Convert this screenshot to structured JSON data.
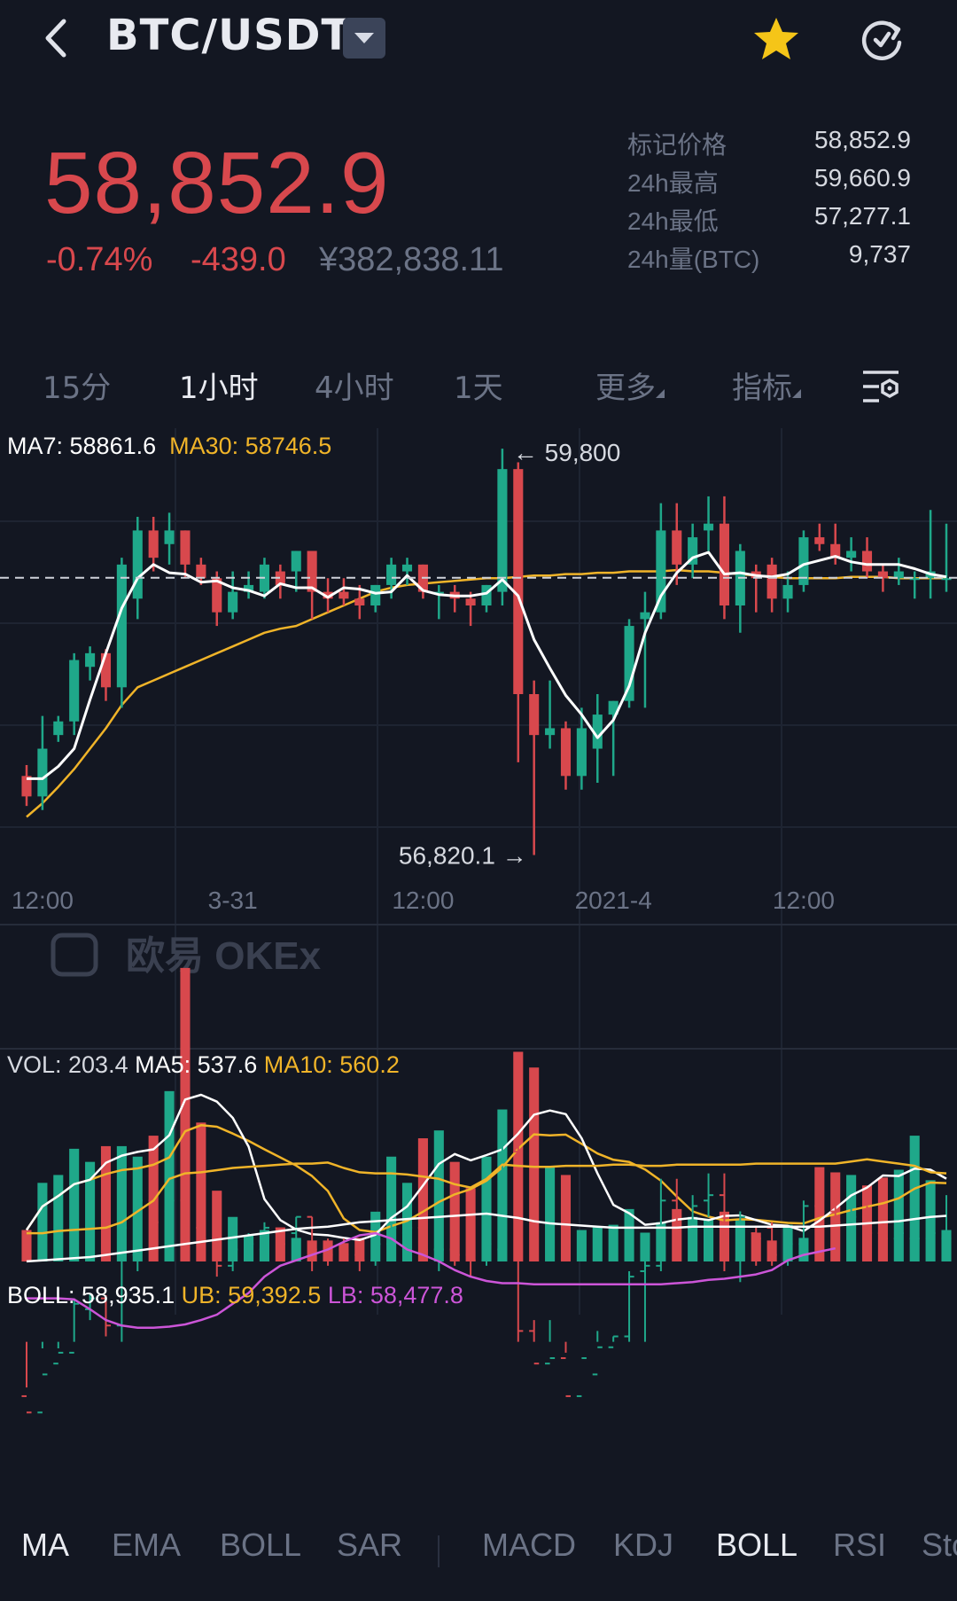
{
  "header": {
    "pair": "BTC/USDT",
    "icons": {
      "back": "back-chevron-icon",
      "dropdown": "triangle-down-icon",
      "favorite": "star-icon",
      "refresh": "refresh-icon"
    },
    "star_color": "#f5c518"
  },
  "ticker": {
    "last_price": "58,852.9",
    "change_pct": "-0.74%",
    "change_abs": "-439.0",
    "cny_value": "¥382,838.11",
    "down_color": "#d8484d"
  },
  "stats": [
    {
      "label": "标记价格",
      "value": "58,852.9"
    },
    {
      "label": "24h最高",
      "value": "59,660.9"
    },
    {
      "label": "24h最低",
      "value": "57,277.1"
    },
    {
      "label": "24h量(BTC)",
      "value": "9,737"
    }
  ],
  "intervals": [
    {
      "label": "15分",
      "active": false
    },
    {
      "label": "1小时",
      "active": true
    },
    {
      "label": "4小时",
      "active": false
    },
    {
      "label": "1天",
      "active": false
    },
    {
      "label": "更多",
      "active": false
    },
    {
      "label": "指标",
      "active": false
    }
  ],
  "main_legend": {
    "ma7": "MA7: 58861.6",
    "ma30": "MA30: 58746.5"
  },
  "annotations": {
    "high": "← 59,800",
    "low": "56,820.1 →",
    "watermark": "欧易 OKEx"
  },
  "time_axis": [
    "12:00",
    "3-31",
    "12:00",
    "2021-4",
    "12:00"
  ],
  "vol_legend": {
    "vol": "VOL: 203.4",
    "ma5": "MA5: 537.6",
    "ma10": "MA10: 560.2"
  },
  "boll_legend": {
    "boll": "BOLL: 58,935.1",
    "ub": "UB: 59,392.5",
    "lb": "LB: 58,477.8"
  },
  "bottom_tabs_main": [
    {
      "label": "MA",
      "active": true
    },
    {
      "label": "EMA",
      "active": false
    },
    {
      "label": "BOLL",
      "active": false
    },
    {
      "label": "SAR",
      "active": false
    }
  ],
  "bottom_tabs_sub": [
    {
      "label": "MACD",
      "active": false
    },
    {
      "label": "KDJ",
      "active": false
    },
    {
      "label": "BOLL",
      "active": true
    },
    {
      "label": "RSI",
      "active": false
    },
    {
      "label": "StochRSI",
      "active": false
    }
  ],
  "colors": {
    "up": "#1fa88a",
    "down": "#d8484d",
    "ma30": "#f0b429",
    "lb": "#cc55d8",
    "ma7": "#ffffff"
  },
  "chart_data": {
    "type": "candlestick",
    "interval": "1h",
    "note_high": 59800,
    "note_low": 56820.1,
    "current_price": 58852.9,
    "candles": [
      {
        "o": 57400,
        "h": 57480,
        "l": 57180,
        "c": 57250
      },
      {
        "o": 57250,
        "h": 57840,
        "l": 57150,
        "c": 57600
      },
      {
        "o": 57700,
        "h": 57840,
        "l": 57650,
        "c": 57800
      },
      {
        "o": 57800,
        "h": 58300,
        "l": 57700,
        "c": 58250
      },
      {
        "o": 58200,
        "h": 58350,
        "l": 58100,
        "c": 58300
      },
      {
        "o": 58300,
        "h": 58330,
        "l": 57950,
        "c": 58050
      },
      {
        "o": 58050,
        "h": 59000,
        "l": 57900,
        "c": 58950
      },
      {
        "o": 58700,
        "h": 59300,
        "l": 58550,
        "c": 59200
      },
      {
        "o": 59200,
        "h": 59300,
        "l": 58900,
        "c": 59000
      },
      {
        "o": 59100,
        "h": 59330,
        "l": 58950,
        "c": 59200
      },
      {
        "o": 59200,
        "h": 59200,
        "l": 58850,
        "c": 58950
      },
      {
        "o": 58950,
        "h": 59000,
        "l": 58800,
        "c": 58850
      },
      {
        "o": 58850,
        "h": 58900,
        "l": 58500,
        "c": 58600
      },
      {
        "o": 58600,
        "h": 58900,
        "l": 58550,
        "c": 58750
      },
      {
        "o": 58750,
        "h": 58900,
        "l": 58700,
        "c": 58800
      },
      {
        "o": 58750,
        "h": 59000,
        "l": 58700,
        "c": 58950
      },
      {
        "o": 58900,
        "h": 58950,
        "l": 58700,
        "c": 58800
      },
      {
        "o": 58900,
        "h": 59050,
        "l": 58750,
        "c": 59050
      },
      {
        "o": 59050,
        "h": 59050,
        "l": 58550,
        "c": 58750
      },
      {
        "o": 58750,
        "h": 58850,
        "l": 58600,
        "c": 58700
      },
      {
        "o": 58750,
        "h": 58850,
        "l": 58650,
        "c": 58700
      },
      {
        "o": 58700,
        "h": 58800,
        "l": 58550,
        "c": 58650
      },
      {
        "o": 58650,
        "h": 58800,
        "l": 58600,
        "c": 58800
      },
      {
        "o": 58800,
        "h": 59000,
        "l": 58700,
        "c": 58950
      },
      {
        "o": 58900,
        "h": 59000,
        "l": 58800,
        "c": 58950
      },
      {
        "o": 58950,
        "h": 58950,
        "l": 58700,
        "c": 58750
      },
      {
        "o": 58750,
        "h": 58800,
        "l": 58550,
        "c": 58750
      },
      {
        "o": 58750,
        "h": 58800,
        "l": 58600,
        "c": 58700
      },
      {
        "o": 58700,
        "h": 58750,
        "l": 58500,
        "c": 58650
      },
      {
        "o": 58650,
        "h": 58800,
        "l": 58600,
        "c": 58800
      },
      {
        "o": 58750,
        "h": 59800,
        "l": 58650,
        "c": 59650
      },
      {
        "o": 59650,
        "h": 59700,
        "l": 57500,
        "c": 58000
      },
      {
        "o": 58000,
        "h": 58100,
        "l": 56820.1,
        "c": 57700
      },
      {
        "o": 57700,
        "h": 58100,
        "l": 57600,
        "c": 57750
      },
      {
        "o": 57750,
        "h": 57800,
        "l": 57300,
        "c": 57400
      },
      {
        "o": 57400,
        "h": 57900,
        "l": 57300,
        "c": 57750
      },
      {
        "o": 57600,
        "h": 58000,
        "l": 57350,
        "c": 57850
      },
      {
        "o": 57850,
        "h": 57950,
        "l": 57400,
        "c": 57950
      },
      {
        "o": 57950,
        "h": 58550,
        "l": 57900,
        "c": 58500
      },
      {
        "o": 58550,
        "h": 58750,
        "l": 57900,
        "c": 58600
      },
      {
        "o": 58600,
        "h": 59400,
        "l": 58550,
        "c": 59200
      },
      {
        "o": 59200,
        "h": 59400,
        "l": 58800,
        "c": 58950
      },
      {
        "o": 58950,
        "h": 59250,
        "l": 58850,
        "c": 59150
      },
      {
        "o": 59200,
        "h": 59450,
        "l": 59050,
        "c": 59250
      },
      {
        "o": 59250,
        "h": 59450,
        "l": 58550,
        "c": 58650
      },
      {
        "o": 58650,
        "h": 59100,
        "l": 58450,
        "c": 59050
      },
      {
        "o": 58900,
        "h": 58950,
        "l": 58600,
        "c": 58850
      },
      {
        "o": 58950,
        "h": 59000,
        "l": 58600,
        "c": 58700
      },
      {
        "o": 58700,
        "h": 58900,
        "l": 58600,
        "c": 58800
      },
      {
        "o": 58800,
        "h": 59200,
        "l": 58750,
        "c": 59150
      },
      {
        "o": 59150,
        "h": 59250,
        "l": 59050,
        "c": 59100
      },
      {
        "o": 59100,
        "h": 59250,
        "l": 58950,
        "c": 59000
      },
      {
        "o": 59000,
        "h": 59150,
        "l": 58900,
        "c": 59050
      },
      {
        "o": 59050,
        "h": 59150,
        "l": 58850,
        "c": 58900
      },
      {
        "o": 58900,
        "h": 58950,
        "l": 58750,
        "c": 58850
      },
      {
        "o": 58850,
        "h": 59000,
        "l": 58800,
        "c": 58900
      },
      {
        "o": 58850,
        "h": 58900,
        "l": 58700,
        "c": 58850
      },
      {
        "o": 58850,
        "h": 59350,
        "l": 58700,
        "c": 58900
      },
      {
        "o": 58850,
        "h": 59250,
        "l": 58750,
        "c": 58850
      }
    ],
    "volume": [
      120,
      300,
      330,
      430,
      380,
      440,
      440,
      400,
      480,
      650,
      1120,
      530,
      270,
      170,
      100,
      120,
      130,
      90,
      80,
      80,
      70,
      90,
      190,
      400,
      300,
      470,
      500,
      380,
      280,
      400,
      580,
      800,
      740,
      360,
      330,
      120,
      130,
      140,
      200,
      110,
      150,
      200,
      170,
      160,
      190,
      160,
      110,
      80,
      140,
      90,
      360,
      340,
      330,
      290,
      320,
      350,
      480,
      310,
      120
    ],
    "ma7": [
      57380,
      57380,
      57470,
      57600,
      57960,
      58300,
      58630,
      58850,
      58950,
      58890,
      58880,
      58820,
      58830,
      58780,
      58760,
      58720,
      58810,
      58780,
      58780,
      58710,
      58780,
      58770,
      58740,
      58750,
      58870,
      58760,
      58730,
      58720,
      58720,
      58740,
      58840,
      58720,
      58400,
      58190,
      57990,
      57850,
      57680,
      57810,
      58060,
      58450,
      58720,
      58890,
      59000,
      59040,
      58880,
      58890,
      58870,
      58860,
      58880,
      58950,
      58980,
      59010,
      58970,
      58950,
      58950,
      58950,
      58920,
      58880,
      58860
    ],
    "ma30": [
      57100,
      57200,
      57320,
      57450,
      57600,
      57750,
      57920,
      58050,
      58100,
      58150,
      58200,
      58250,
      58300,
      58350,
      58400,
      58450,
      58480,
      58500,
      58550,
      58600,
      58650,
      58700,
      58750,
      58780,
      58800,
      58810,
      58820,
      58830,
      58840,
      58850,
      58850,
      58860,
      58870,
      58870,
      58880,
      58880,
      58890,
      58890,
      58900,
      58900,
      58900,
      58910,
      58900,
      58900,
      58890,
      58880,
      58870,
      58860,
      58850,
      58850,
      58850,
      58850,
      58860,
      58860,
      58860,
      58850,
      58850,
      58850,
      58850
    ],
    "boll_mid": [
      58640,
      58650,
      58660,
      58670,
      58680,
      58700,
      58720,
      58740,
      58760,
      58780,
      58800,
      58820,
      58840,
      58860,
      58880,
      58900,
      58920,
      58940,
      58950,
      58960,
      58980,
      59000,
      59010,
      59020,
      59030,
      59040,
      59050,
      59060,
      59070,
      59080,
      59060,
      59040,
      59010,
      58990,
      58980,
      58970,
      58960,
      58950,
      58950,
      58950,
      58950,
      58950,
      58960,
      58960,
      58960,
      58960,
      58960,
      58960,
      58960,
      58960,
      58960,
      58970,
      58980,
      58990,
      59000,
      59010,
      59030,
      59050,
      59060
    ],
    "boll_ub": [
      58900,
      58900,
      58920,
      58930,
      58940,
      58950,
      59000,
      59100,
      59200,
      59400,
      59450,
      59460,
      59480,
      59500,
      59510,
      59520,
      59530,
      59540,
      59540,
      59550,
      59500,
      59460,
      59450,
      59450,
      59440,
      59420,
      59400,
      59350,
      59320,
      59400,
      59530,
      59520,
      59510,
      59510,
      59520,
      59520,
      59520,
      59530,
      59530,
      59520,
      59520,
      59530,
      59530,
      59530,
      59530,
      59530,
      59540,
      59540,
      59540,
      59540,
      59540,
      59540,
      59560,
      59580,
      59560,
      59540,
      59520,
      59460,
      59450
    ],
    "boll_lb": [
      58300,
      58300,
      58300,
      58290,
      58200,
      58100,
      58050,
      58030,
      58030,
      58040,
      58060,
      58100,
      58150,
      58250,
      58350,
      58500,
      58600,
      58650,
      58700,
      58750,
      58820,
      58880,
      58900,
      58850,
      58750,
      58700,
      58640,
      58560,
      58500,
      58460,
      58440,
      58440,
      58430,
      58430,
      58430,
      58430,
      58430,
      58430,
      58430,
      58430,
      58430,
      58440,
      58450,
      58470,
      58480,
      58500,
      58520,
      58560,
      58650,
      58700,
      58730,
      58760
    ]
  }
}
